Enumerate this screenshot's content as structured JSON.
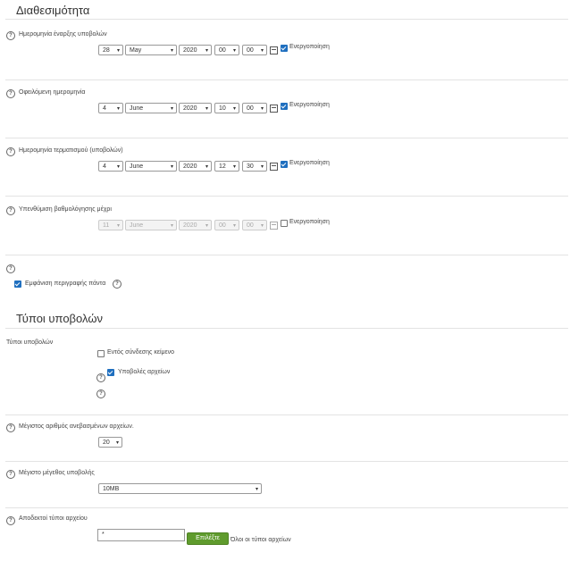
{
  "availability": {
    "title": "Διαθεσιμότητα",
    "rows": [
      {
        "label": "Ημερομηνία έναρξης υποβολών",
        "day": "28",
        "month": "May",
        "year": "2020",
        "hour": "00",
        "minute": "00",
        "enable_label": "Ενεργοποίηση",
        "enabled": true
      },
      {
        "label": "Οφειλόμενη ημερομηνία",
        "day": "4",
        "month": "June",
        "year": "2020",
        "hour": "10",
        "minute": "00",
        "enable_label": "Ενεργοποίηση",
        "enabled": true
      },
      {
        "label": "Ημερομηνία τερματισμού (υποβολών)",
        "day": "4",
        "month": "June",
        "year": "2020",
        "hour": "12",
        "minute": "30",
        "enable_label": "Ενεργοποίηση",
        "enabled": true
      },
      {
        "label": "Υπενθύμιση βαθμολόγησης μέχρι",
        "day": "11",
        "month": "June",
        "year": "2020",
        "hour": "00",
        "minute": "00",
        "enable_label": "Ενεργοποίηση",
        "enabled": false
      }
    ],
    "always_show_label": "Εμφάνιση περιγραφής πάντα",
    "always_show_checked": true
  },
  "submission_types": {
    "title": "Τύποι υποβολών",
    "label": "Τύποι υποβολών",
    "online_text_label": "Εντός σύνδεσης κείμενο",
    "online_text_checked": false,
    "file_submissions_label": "Υποβολές αρχείων",
    "file_submissions_checked": true,
    "max_files_label": "Μέγιστος αριθμός ανεβασμένων αρχείων.",
    "max_files_value": "20",
    "max_size_label": "Μέγιστο μέγεθος υποβολής",
    "max_size_value": "10MB",
    "accepted_types_label": "Αποδεκτοί τύποι αρχείου",
    "accepted_types_value": "*",
    "choose_button": "Επιλέξτε",
    "all_types_text": "Όλοι οι τύποι αρχείων"
  }
}
